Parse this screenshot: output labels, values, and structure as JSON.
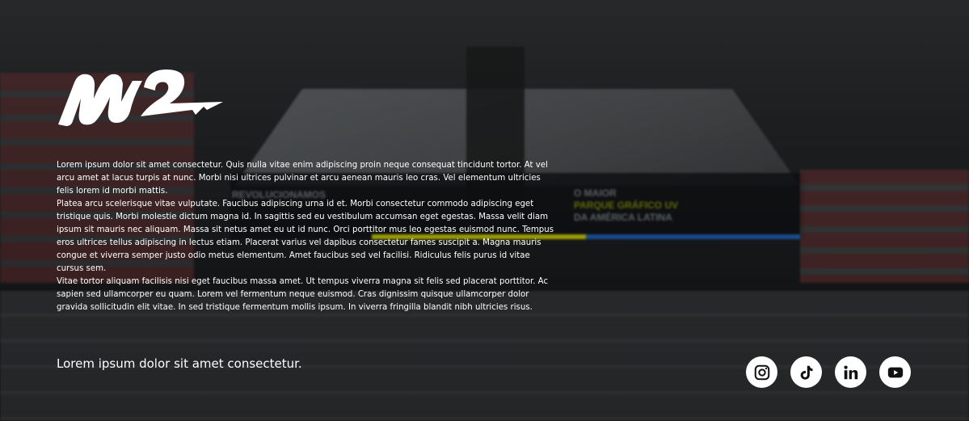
{
  "brand": {
    "logo_name": "M2"
  },
  "background": {
    "billboard_left": "REVOLUCIONAMOS",
    "billboard_right_line1": "O MAIOR",
    "billboard_right_line2": "PARQUE GRÁFICO UV",
    "billboard_right_line3": "DA AMÉRICA LATINA"
  },
  "body": {
    "paragraphs": [
      "Lorem ipsum dolor sit amet consectetur. Quis nulla vitae enim adipiscing proin neque consequat tincidunt tortor. At vel arcu amet at lacus turpis at nunc. Morbi nisi ultrices pulvinar et arcu aenean mauris leo cras. Vel elementum ultricies felis lorem id morbi mattis.",
      "Platea arcu scelerisque vitae vulputate. Faucibus adipiscing urna id et. Morbi consectetur commodo adipiscing eget tristique quis. Morbi molestie dictum magna id. In sagittis sed eu vestibulum accumsan eget egestas. Massa velit diam ipsum sit mauris nec aliquam. Massa sit netus amet eu ut id nunc. Orci porttitor mus leo egestas euismod nunc. Tempus eros ultrices tellus adipiscing in lectus etiam. Placerat varius vel dapibus consectetur fames suscipit a. Magna mauris congue et viverra semper justo odio metus elementum. Amet faucibus sed vel facilisi. Ridiculus felis purus id vitae cursus sem.",
      "Vitae tortor aliquam facilisis nisi eget faucibus massa amet. Ut tempus viverra magna sit felis sed placerat porttitor. Ac sapien sed ullamcorper eu quam. Lorem vel fermentum neque euismod. Cras dignissim quisque ullamcorper dolor gravida sollicitudin elit vitae. In sed tristique fermentum mollis ipsum. In viverra fringilla blandit nibh ultricies risus."
    ]
  },
  "tagline": "Lorem ipsum dolor sit amet consectetur.",
  "social": [
    {
      "name": "instagram",
      "icon": "instagram-icon"
    },
    {
      "name": "tiktok",
      "icon": "tiktok-icon"
    },
    {
      "name": "linkedin",
      "icon": "linkedin-icon"
    },
    {
      "name": "youtube",
      "icon": "youtube-icon"
    }
  ],
  "colors": {
    "text": "#ffffff",
    "icon_bg": "#ffffff",
    "icon_fg": "#111111"
  }
}
